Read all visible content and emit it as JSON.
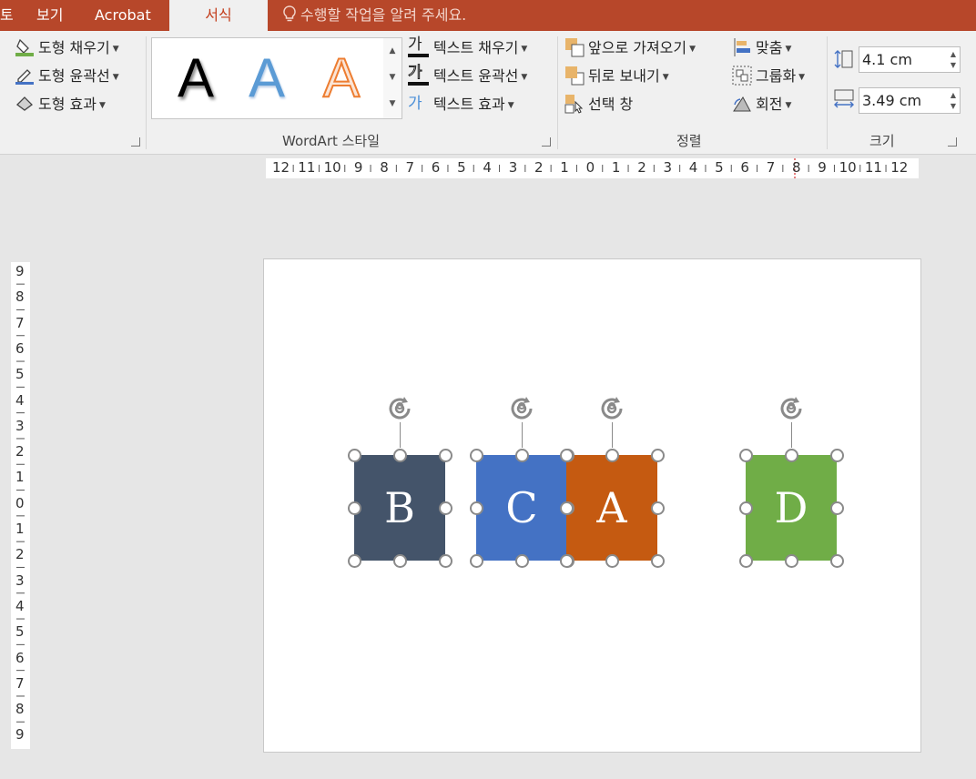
{
  "tabs": {
    "partial": "토",
    "view": "보기",
    "acrobat": "Acrobat",
    "format": "서식"
  },
  "tell_me": "수행할 작업을 알려 주세요.",
  "shape_styles": {
    "fill": "도형 채우기",
    "outline": "도형 윤곽선",
    "effects": "도형 효과"
  },
  "wordart": {
    "group_label": "WordArt 스타일",
    "gallery": [
      "A",
      "A",
      "A"
    ],
    "text_fill": "텍스트 채우기",
    "text_outline": "텍스트 윤곽선",
    "text_effects": "텍스트 효과",
    "text_icon": "가"
  },
  "arrange": {
    "group_label": "정렬",
    "bring_forward": "앞으로 가져오기",
    "send_backward": "뒤로 보내기",
    "selection_pane": "선택 창",
    "align": "맞춤",
    "group": "그룹화",
    "rotate": "회전"
  },
  "size": {
    "group_label": "크기",
    "height": "4.1 cm",
    "width": "3.49 cm"
  },
  "ruler": {
    "horizontal": [
      "12",
      "11",
      "10",
      "9",
      "8",
      "7",
      "6",
      "5",
      "4",
      "3",
      "2",
      "1",
      "0",
      "1",
      "2",
      "3",
      "4",
      "5",
      "6",
      "7",
      "8",
      "9",
      "10",
      "11",
      "12"
    ],
    "vertical": [
      "9",
      "8",
      "7",
      "6",
      "5",
      "4",
      "3",
      "2",
      "1",
      "0",
      "1",
      "2",
      "3",
      "4",
      "5",
      "6",
      "7",
      "8",
      "9"
    ]
  },
  "shapes": [
    {
      "label": "B",
      "color": "#44546a"
    },
    {
      "label": "C",
      "color": "#4472c4"
    },
    {
      "label": "A",
      "color": "#c55a11"
    },
    {
      "label": "D",
      "color": "#70ad47"
    }
  ],
  "colors": {
    "tab_bar": "#b7472a",
    "active_tab_text": "#c43e1c",
    "handle": "#8a8a8a"
  }
}
